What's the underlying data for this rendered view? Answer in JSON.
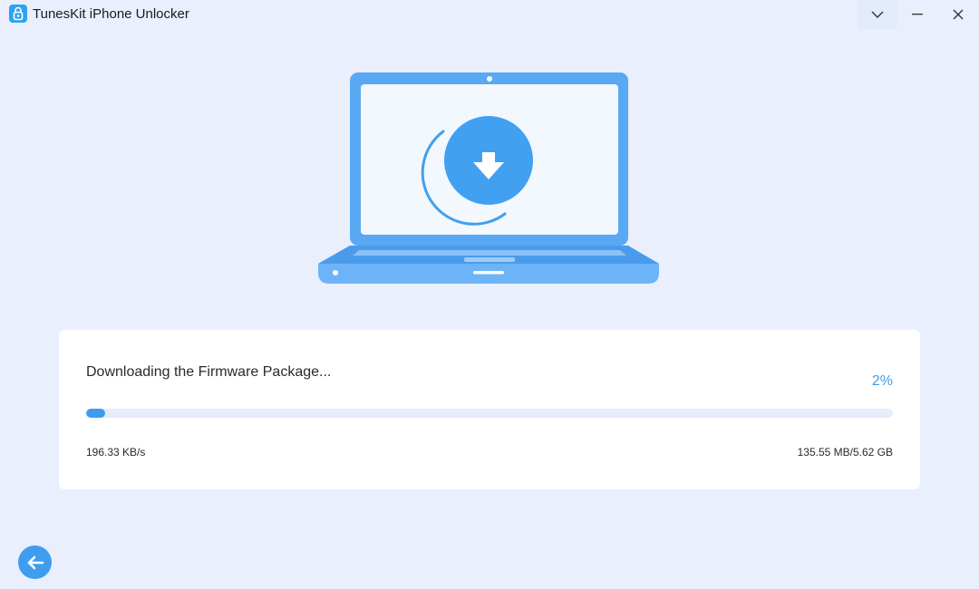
{
  "window": {
    "title": "TunesKit iPhone Unlocker",
    "icons": {
      "logo": "lock-logo-icon",
      "menu": "chevron-down-icon",
      "minimize": "minimize-icon",
      "close": "close-icon"
    }
  },
  "illustration": {
    "icon": "download-arrow-icon",
    "colors": {
      "accent": "#3e9cec",
      "screen": "#f3f7fe",
      "body": "#5eaaf4"
    }
  },
  "download": {
    "status": "Downloading the Firmware Package...",
    "percent_label": "2%",
    "progress": 0.02,
    "speed": "196.33 KB/s",
    "size": "135.55 MB/5.62 GB"
  },
  "nav": {
    "back_icon": "arrow-left-icon"
  }
}
